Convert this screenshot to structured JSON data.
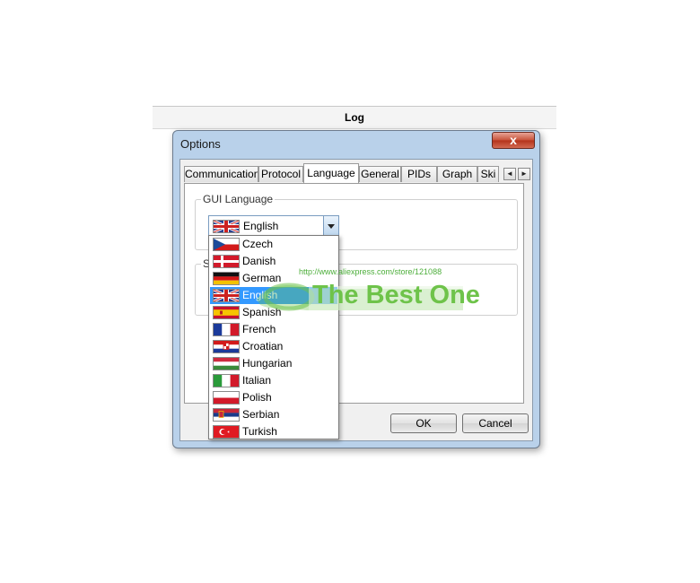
{
  "log_window": {
    "title": "Log"
  },
  "dialog": {
    "title": "Options",
    "close_glyph": "x"
  },
  "tabs": [
    {
      "label": "Communication",
      "active": false
    },
    {
      "label": "Protocol",
      "active": false
    },
    {
      "label": "Language",
      "active": true
    },
    {
      "label": "General",
      "active": false
    },
    {
      "label": "PIDs",
      "active": false
    },
    {
      "label": "Graph",
      "active": false
    },
    {
      "label": "Ski",
      "active": false
    }
  ],
  "tab_scroll": {
    "left_glyph": "◄",
    "right_glyph": "►"
  },
  "gui_language": {
    "legend": "GUI Language",
    "selected": "English",
    "selected_icon": "flag-uk-icon"
  },
  "second_group": {
    "legend": "S"
  },
  "languages": [
    {
      "label": "Czech",
      "icon": "flag-czech-icon",
      "selected": false
    },
    {
      "label": "Danish",
      "icon": "flag-danish-icon",
      "selected": false
    },
    {
      "label": "German",
      "icon": "flag-german-icon",
      "selected": false
    },
    {
      "label": "English",
      "icon": "flag-uk-icon",
      "selected": true
    },
    {
      "label": "Spanish",
      "icon": "flag-spanish-icon",
      "selected": false
    },
    {
      "label": "French",
      "icon": "flag-french-icon",
      "selected": false
    },
    {
      "label": "Croatian",
      "icon": "flag-croatian-icon",
      "selected": false
    },
    {
      "label": "Hungarian",
      "icon": "flag-hungarian-icon",
      "selected": false
    },
    {
      "label": "Italian",
      "icon": "flag-italian-icon",
      "selected": false
    },
    {
      "label": "Polish",
      "icon": "flag-polish-icon",
      "selected": false
    },
    {
      "label": "Serbian",
      "icon": "flag-serbian-icon",
      "selected": false
    },
    {
      "label": "Turkish",
      "icon": "flag-turkish-icon",
      "selected": false
    }
  ],
  "buttons": {
    "ok": "OK",
    "cancel": "Cancel"
  },
  "watermark": {
    "url": "http://www.aliexpress.com/store/121088",
    "text": "The Best One",
    "color": "#6ec34a"
  },
  "colors": {
    "selection": "#3399ff",
    "dialog_frame": "#b9d1ea"
  }
}
